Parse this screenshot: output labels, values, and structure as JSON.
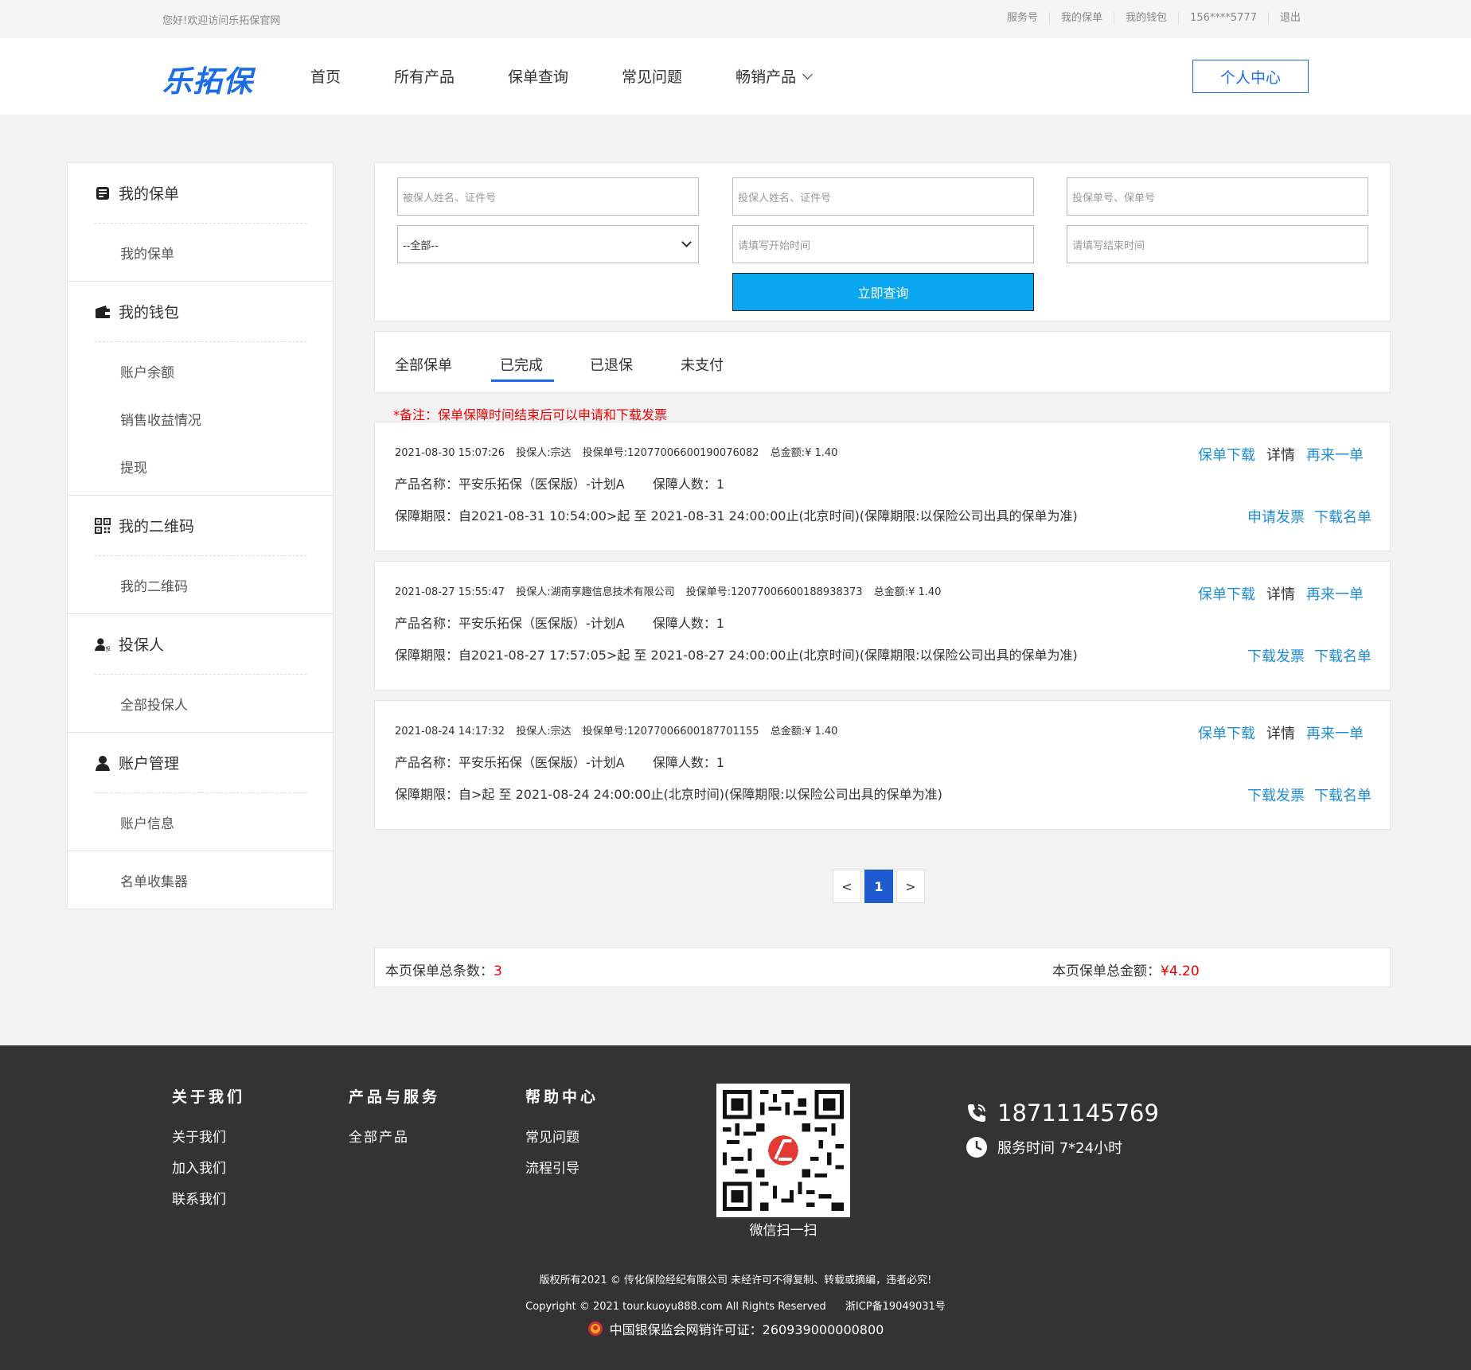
{
  "topbar": {
    "welcome": "您好!欢迎访问乐拓保官网",
    "links": [
      "服务号",
      "我的保单",
      "我的钱包",
      "156****5777",
      "退出"
    ]
  },
  "header": {
    "logo": "乐拓保",
    "nav": [
      "首页",
      "所有产品",
      "保单查询",
      "常见问题",
      "畅销产品"
    ],
    "center_button": "个人中心"
  },
  "sidebar": {
    "sections": [
      {
        "title": "我的保单",
        "icon": "policy-icon",
        "items": [
          "我的保单"
        ]
      },
      {
        "title": "我的钱包",
        "icon": "wallet-icon",
        "items": [
          "账户余额",
          "销售收益情况",
          "提现"
        ]
      },
      {
        "title": "我的二维码",
        "icon": "qrcode-icon",
        "items": [
          "我的二维码"
        ]
      },
      {
        "title": "投保人",
        "icon": "applicant-icon",
        "items": [
          "全部投保人"
        ]
      },
      {
        "title": "账户管理",
        "icon": "user-icon",
        "items": [
          "账户信息"
        ]
      }
    ],
    "extra_item": "名单收集器"
  },
  "search": {
    "insured_placeholder": "被保人姓名、证件号",
    "applicant_placeholder": "投保人姓名、证件号",
    "policy_placeholder": "投保单号、保单号",
    "select_value": "--全部--",
    "start_placeholder": "请填写开始时间",
    "end_placeholder": "请填写结束时间",
    "query_button": "立即查询"
  },
  "tabs": {
    "items": [
      "全部保单",
      "已完成",
      "已退保",
      "未支付"
    ],
    "active": "已完成"
  },
  "note": "*备注：保单保障时间结束后可以申请和下载发票",
  "orders": [
    {
      "time": "2021-08-30 15:07:26",
      "applicant": "投保人:宗达",
      "policy_no": "投保单号:12077006600190076082",
      "amount": "总金额:¥ 1.40",
      "product": "产品名称：平安乐拓保（医保版）-计划A",
      "insured_count": "保障人数：1",
      "period": "保障期限：自2021-08-31 10:54:00>起 至  2021-08-31 24:00:00止(北京时间)(保障期限:以保险公司出具的保单为准)",
      "actions1": [
        "保单下载",
        "详情",
        "再来一单"
      ],
      "actions2": [
        "申请发票",
        "下载名单"
      ]
    },
    {
      "time": "2021-08-27 15:55:47",
      "applicant": "投保人:湖南享趣信息技术有限公司",
      "policy_no": "投保单号:12077006600188938373",
      "amount": "总金额:¥ 1.40",
      "product": "产品名称：平安乐拓保（医保版）-计划A",
      "insured_count": "保障人数：1",
      "period": "保障期限：自2021-08-27 17:57:05>起 至  2021-08-27 24:00:00止(北京时间)(保障期限:以保险公司出具的保单为准)",
      "actions1": [
        "保单下载",
        "详情",
        "再来一单"
      ],
      "actions2": [
        "下载发票",
        "下载名单"
      ]
    },
    {
      "time": "2021-08-24 14:17:32",
      "applicant": "投保人:宗达",
      "policy_no": "投保单号:12077006600187701155",
      "amount": "总金额:¥ 1.40",
      "product": "产品名称：平安乐拓保（医保版）-计划A",
      "insured_count": "保障人数：1",
      "period": "保障期限：自>起 至  2021-08-24 24:00:00止(北京时间)(保障期限:以保险公司出具的保单为准)",
      "actions1": [
        "保单下载",
        "详情",
        "再来一单"
      ],
      "actions2": [
        "下载发票",
        "下载名单"
      ]
    }
  ],
  "pagination": {
    "prev": "<",
    "current": "1",
    "next": ">"
  },
  "summary": {
    "count_label": "本页保单总条数：",
    "count": "3",
    "total_label": "本页保单总金额：",
    "total": "¥4.20"
  },
  "footer": {
    "cols": [
      {
        "title": "关于我们",
        "items": [
          "关于我们",
          "加入我们",
          "联系我们"
        ]
      },
      {
        "title": "产品与服务",
        "items": [
          "全部产品"
        ]
      },
      {
        "title": "帮助中心",
        "items": [
          "常见问题",
          "流程引导"
        ]
      }
    ],
    "qr_caption": "微信扫一扫",
    "phone": "18711145769",
    "service_time": "服务时间 7*24小时",
    "copyright1": "版权所有2021 © 传化保险经纪有限公司 未经许可不得复制、转载或摘编，违者必究!",
    "copyright2": "Copyright © 2021 tour.kuoyu888.com All Rights Reserved",
    "icp": "浙ICP备19049031号",
    "license": "中国银保监会网销许可证：260939000000800"
  },
  "colors": {
    "brand": "#1a6ce8",
    "query_button": "#0aa7f0",
    "link": "#1e8cd8",
    "alert": "#ee0000",
    "footer_bg": "#333333"
  }
}
